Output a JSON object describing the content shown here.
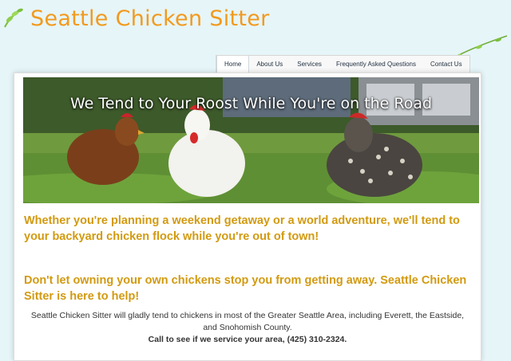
{
  "header": {
    "site_title": "Seattle Chicken Sitter"
  },
  "nav": {
    "items": [
      "Home",
      "About Us",
      "Services",
      "Frequently Asked Questions",
      "Contact Us"
    ],
    "active": "Home"
  },
  "hero": {
    "headline": "We Tend to Your Roost While You're on the Road"
  },
  "main": {
    "lead1": "Whether you're planning a weekend getaway or a world adventure, we'll tend to your backyard chicken flock while you're out of town!",
    "lead2": "Don't let owning your own chickens stop you from getting away. Seattle Chicken Sitter is here to help!",
    "service_area": "Seattle Chicken Sitter will gladly tend to chickens in most of the Greater Seattle Area, including Everett, the Eastside, and Snohomish County.",
    "call_to_action": "Call to see if we service your area, (425) 310-2324."
  },
  "colors": {
    "title": "#f29a1d",
    "lead": "#d29a10",
    "background": "#e6f5f8"
  }
}
